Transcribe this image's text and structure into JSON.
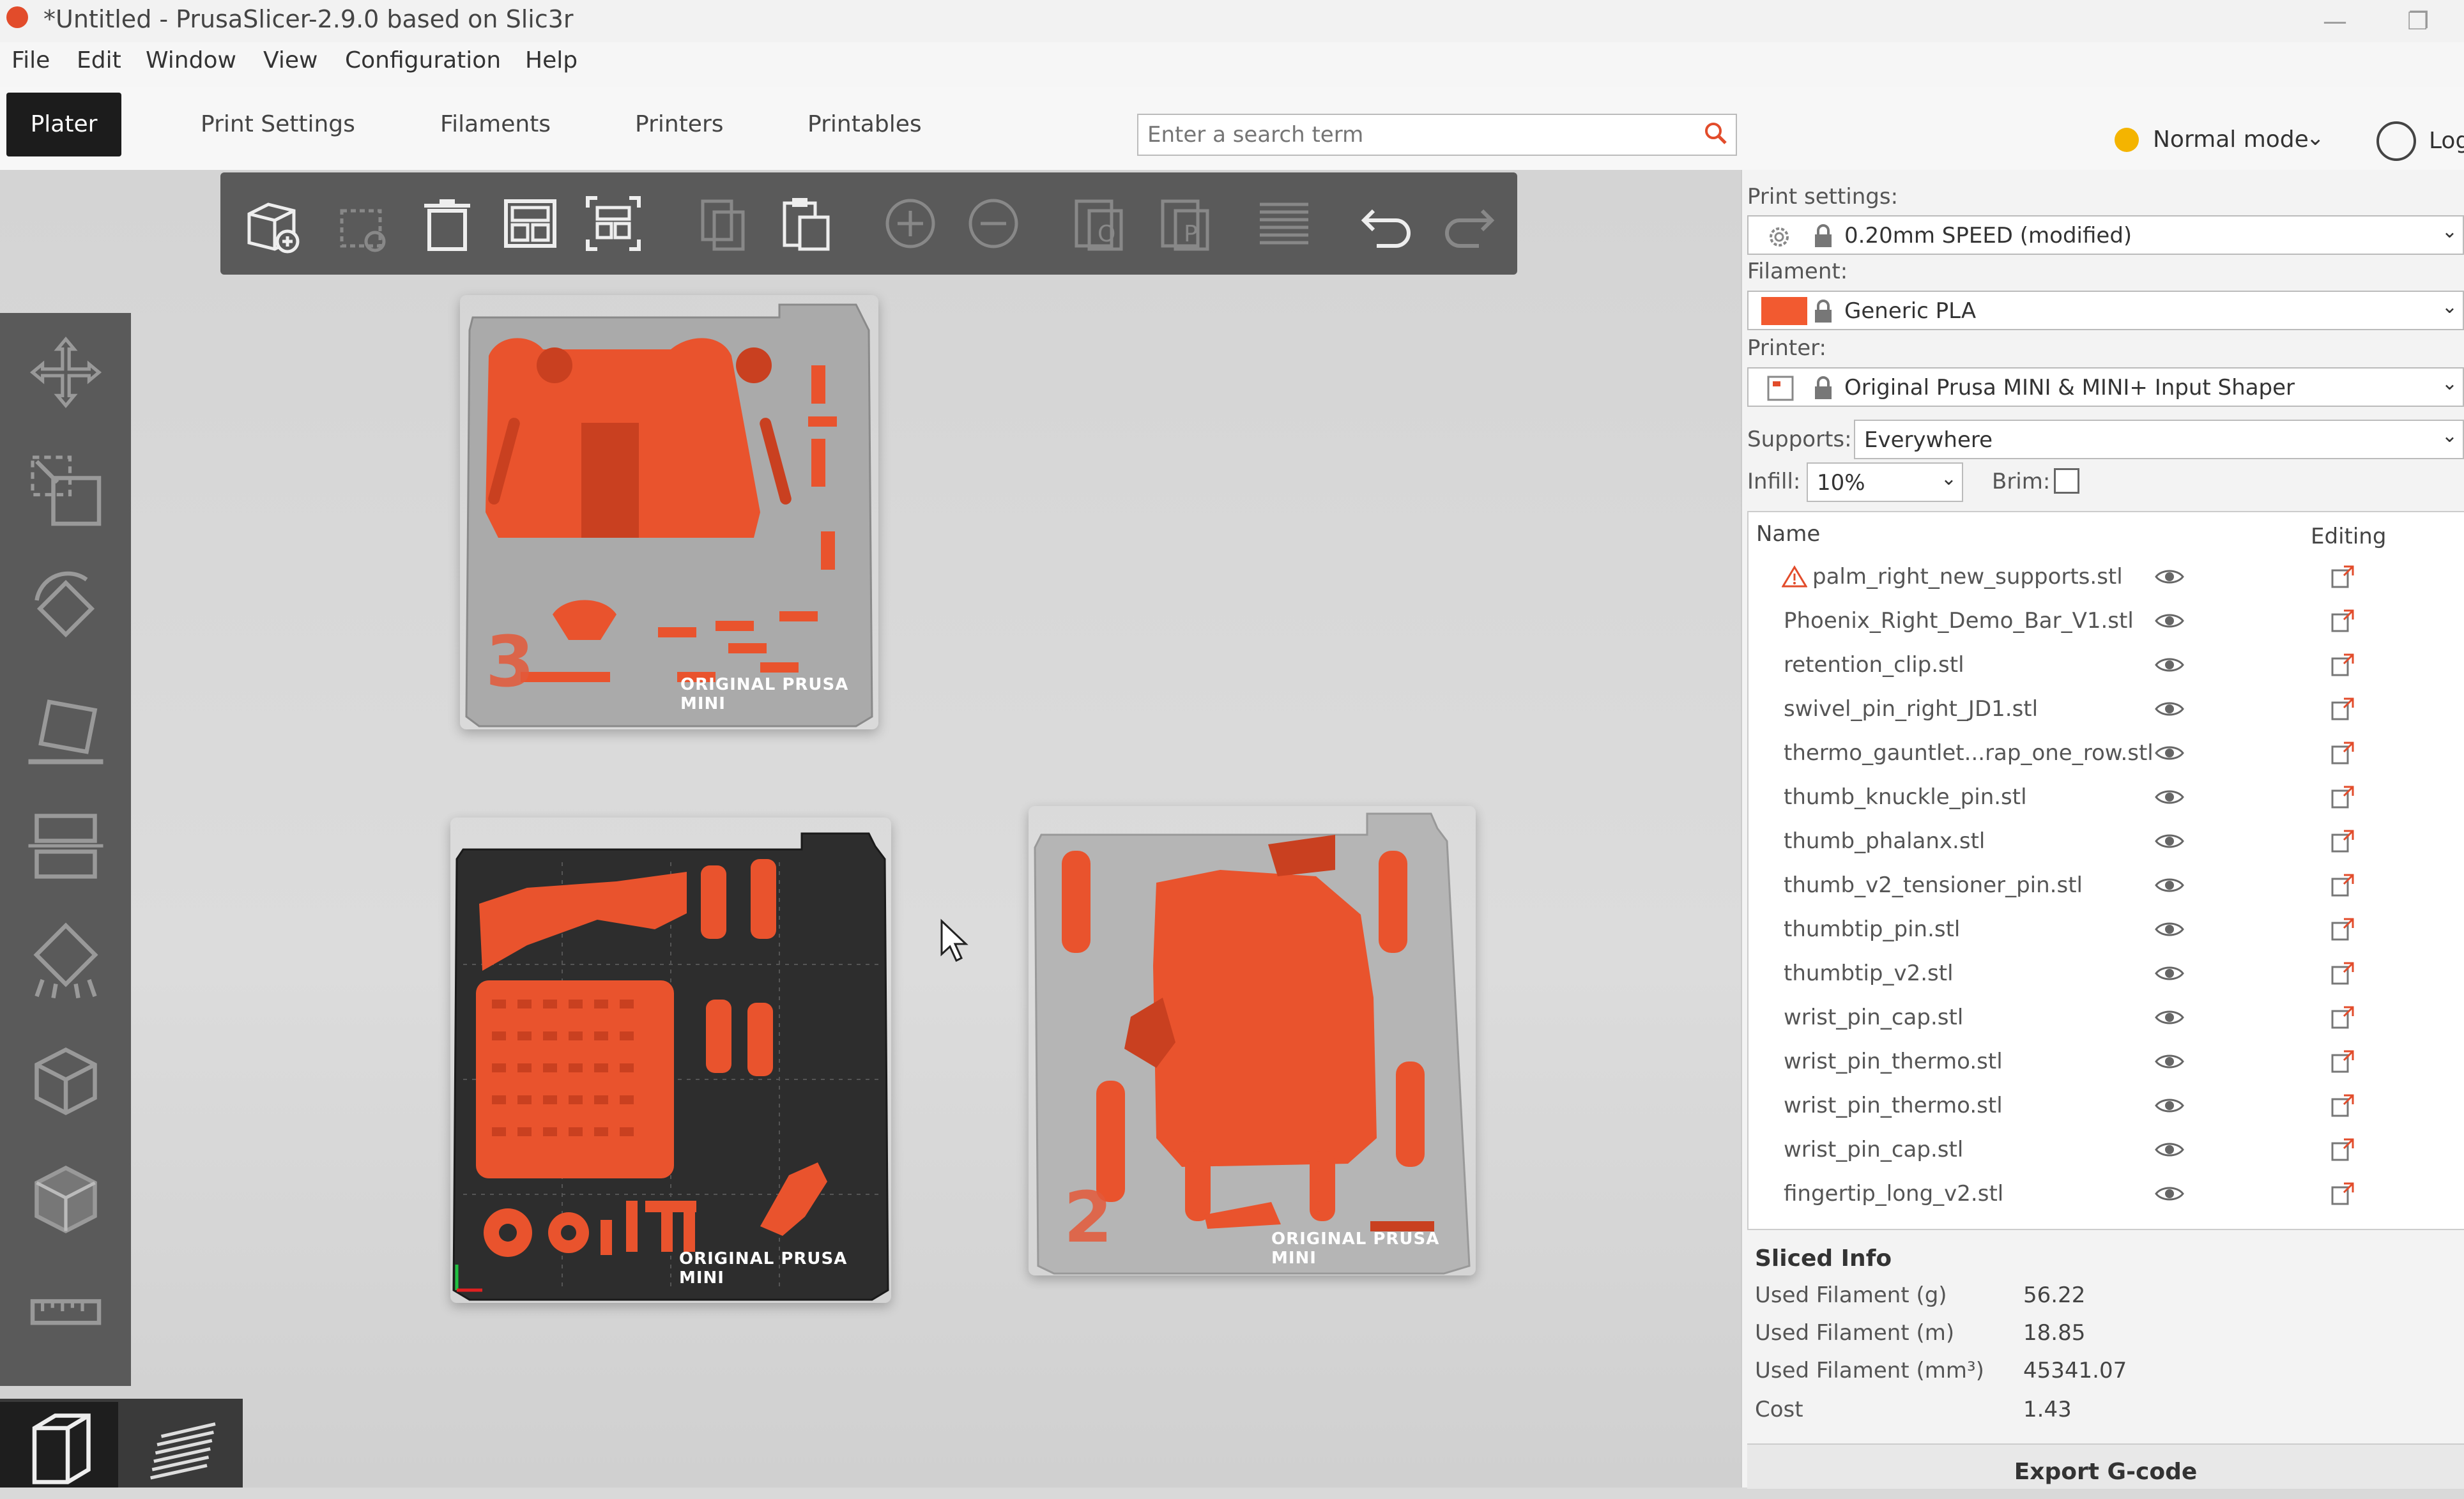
{
  "window": {
    "title": "*Untitled - PrusaSlicer-2.9.0 based on Slic3r",
    "minimize_glyph": "—",
    "restore_glyph": "❐"
  },
  "menu": [
    "File",
    "Edit",
    "Window",
    "View",
    "Configuration",
    "Help"
  ],
  "tabs": [
    "Plater",
    "Print Settings",
    "Filaments",
    "Printers",
    "Printables"
  ],
  "search": {
    "placeholder": "Enter a search term"
  },
  "mode": {
    "label": "Normal mode",
    "color": "#f4b400"
  },
  "account": {
    "label": "Log"
  },
  "toolbar": {
    "icons": [
      "add-icon",
      "delete-icon-disabled",
      "delete-all-icon",
      "arrange-icon",
      "arrange-selection-icon",
      "copy-icon-disabled",
      "paste-icon",
      "add-instance-icon",
      "remove-instance-icon",
      "split-to-objects-icon",
      "split-to-parts-icon",
      "layers-editing-icon",
      "undo-icon",
      "redo-icon"
    ]
  },
  "left_toolbar": {
    "icons": [
      "move-icon",
      "scale-icon",
      "rotate-icon",
      "place-on-face-icon",
      "cut-icon",
      "support-painting-icon",
      "seam-painting-icon",
      "mmu-painting-icon",
      "measure-icon"
    ]
  },
  "beds": [
    {
      "label": "ORIGINAL PRUSA MINI",
      "number": "3"
    },
    {
      "label": "ORIGINAL PRUSA MINI",
      "number": ""
    },
    {
      "label": "ORIGINAL PRUSA MINI",
      "number": "2"
    }
  ],
  "sidebar": {
    "print_settings_label": "Print settings:",
    "print_settings_value": "0.20mm SPEED (modified)",
    "filament_label": "Filament:",
    "filament_value": "Generic PLA",
    "filament_color": "#f25a30",
    "printer_label": "Printer:",
    "printer_value": "Original Prusa MINI & MINI+ Input Shaper",
    "supports_label": "Supports:",
    "supports_value": "Everywhere",
    "infill_label": "Infill:",
    "infill_value": "10%",
    "brim_label": "Brim:"
  },
  "object_list": {
    "col_name": "Name",
    "col_editing": "Editing",
    "items": [
      {
        "name": "palm_right_new_supports.stl",
        "warning": true
      },
      {
        "name": "Phoenix_Right_Demo_Bar_V1.stl",
        "warning": false
      },
      {
        "name": "retention_clip.stl",
        "warning": false
      },
      {
        "name": "swivel_pin_right_JD1.stl",
        "warning": false
      },
      {
        "name": "thermo_gauntlet...rap_one_row.stl",
        "warning": false
      },
      {
        "name": "thumb_knuckle_pin.stl",
        "warning": false
      },
      {
        "name": "thumb_phalanx.stl",
        "warning": false
      },
      {
        "name": "thumb_v2_tensioner_pin.stl",
        "warning": false
      },
      {
        "name": "thumbtip_pin.stl",
        "warning": false
      },
      {
        "name": "thumbtip_v2.stl",
        "warning": false
      },
      {
        "name": "wrist_pin_cap.stl",
        "warning": false
      },
      {
        "name": "wrist_pin_thermo.stl",
        "warning": false
      },
      {
        "name": "wrist_pin_thermo.stl",
        "warning": false
      },
      {
        "name": "wrist_pin_cap.stl",
        "warning": false
      },
      {
        "name": "fingertip_long_v2.stl",
        "warning": false
      }
    ]
  },
  "sliced_info": {
    "title": "Sliced Info",
    "rows": [
      {
        "label": "Used Filament (g)",
        "value": "56.22"
      },
      {
        "label": "Used Filament (m)",
        "value": "18.85"
      },
      {
        "label": "Used Filament (mm³)",
        "value": "45341.07"
      },
      {
        "label": "Cost",
        "value": "1.43"
      }
    ]
  },
  "export_button": "Export G-code",
  "colors": {
    "accent": "#f25a30",
    "toolbar": "#5a5a5a",
    "plater_tab": "#1c1c1c"
  }
}
